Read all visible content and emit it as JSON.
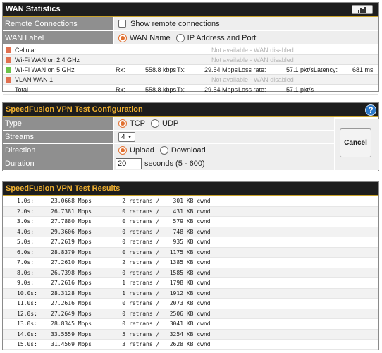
{
  "wan_stats": {
    "title": "WAN Statistics",
    "remote_label": "Remote Connections",
    "show_remote": "Show remote connections",
    "wan_label": "WAN Label",
    "opt_wan_name": "WAN Name",
    "opt_ip_port": "IP Address and Port",
    "rows": [
      {
        "name": "Cellular",
        "color": "#e07050",
        "na": "Not available - WAN disabled"
      },
      {
        "name": "Wi-Fi WAN on 2.4 GHz",
        "color": "#e07050",
        "na": "Not available - WAN disabled"
      },
      {
        "name": "Wi-Fi WAN on 5 GHz",
        "color": "#6cc24a",
        "rx_label": "Rx:",
        "rx": "558.8 kbps",
        "tx_label": "Tx:",
        "tx": "29.54 Mbps",
        "loss_label": "Loss rate:",
        "loss": "57.1 pkt/s",
        "lat_label": "Latency:",
        "lat": "681 ms"
      },
      {
        "name": "VLAN WAN 1",
        "color": "#e07050",
        "na": "Not available - WAN disabled"
      },
      {
        "name": "Total",
        "color": "",
        "rx_label": "Rx:",
        "rx": "558.8 kbps",
        "tx_label": "Tx:",
        "tx": "29.54 Mbps",
        "loss_label": "Loss rate:",
        "loss": "57.1 pkt/s"
      }
    ]
  },
  "config": {
    "title": "SpeedFusion VPN Test Configuration",
    "help": "?",
    "type_label": "Type",
    "tcp": "TCP",
    "udp": "UDP",
    "streams_label": "Streams",
    "streams_value": "4",
    "direction_label": "Direction",
    "upload": "Upload",
    "download": "Download",
    "duration_label": "Duration",
    "duration_value": "20",
    "duration_hint": "seconds (5 - 600)",
    "cancel": "Cancel"
  },
  "results": {
    "title": "SpeedFusion VPN Test Results",
    "lines": [
      "1.0s:     23.0668 Mbps         2 retrans /    301 KB cwnd",
      "2.0s:     26.7381 Mbps         0 retrans /    431 KB cwnd",
      "3.0s:     27.7880 Mbps         0 retrans /    579 KB cwnd",
      "4.0s:     29.3606 Mbps         0 retrans /    748 KB cwnd",
      "5.0s:     27.2619 Mbps         0 retrans /    935 KB cwnd",
      "6.0s:     28.8379 Mbps         0 retrans /   1175 KB cwnd",
      "7.0s:     27.2610 Mbps         2 retrans /   1385 KB cwnd",
      "8.0s:     26.7398 Mbps         0 retrans /   1585 KB cwnd",
      "9.0s:     27.2616 Mbps         1 retrans /   1798 KB cwnd",
      "10.0s:    28.3128 Mbps         1 retrans /   1912 KB cwnd",
      "11.0s:    27.2616 Mbps         0 retrans /   2073 KB cwnd",
      "12.0s:    27.2649 Mbps         0 retrans /   2506 KB cwnd",
      "13.0s:    28.8345 Mbps         0 retrans /   3041 KB cwnd",
      "14.0s:    33.5559 Mbps         5 retrans /   3254 KB cwnd",
      "15.0s:    31.4569 Mbps         3 retrans /   2628 KB cwnd"
    ]
  }
}
